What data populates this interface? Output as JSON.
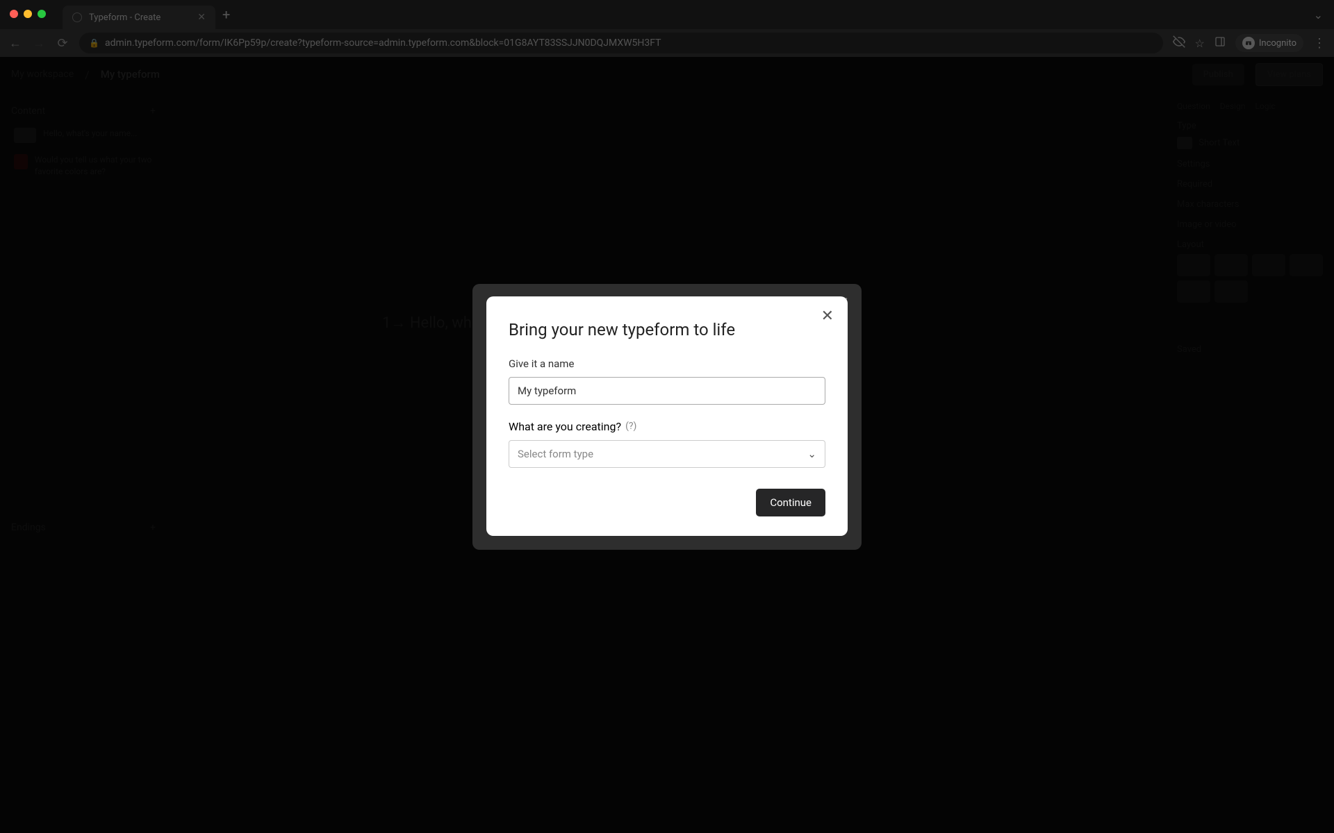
{
  "browser": {
    "tab_title": "Typeform - Create",
    "url": "admin.typeform.com/form/IK6Pp59p/create?typeform-source=admin.typeform.com&block=01G8AYT83SSJJN0DQJMXW5H3FT",
    "incognito_label": "Incognito"
  },
  "app": {
    "breadcrumb": "My workspace",
    "title": "My typeform",
    "publish_button": "Publish",
    "viewplans_button": "View plans",
    "sidebar": {
      "content_label": "Content",
      "questions": [
        {
          "label": "Hello, what's your name..."
        },
        {
          "label": "Would you tell us what your two favorite colors are?"
        }
      ],
      "endings_label": "Endings"
    },
    "canvas": {
      "question_prefix": "1→",
      "question_text": "Hello, wha"
    },
    "rightpanel": {
      "tabs": [
        "Question",
        "Design",
        "Logic"
      ],
      "type_label": "Type",
      "type_value": "Short Text",
      "settings_label": "Settings",
      "required_label": "Required",
      "max_chars_label": "Max characters",
      "image_video_label": "Image or video",
      "layout_label": "Layout",
      "saved_label": "Saved"
    }
  },
  "modal": {
    "title": "Bring your new typeform to life",
    "name_label": "Give it a name",
    "name_value": "My typeform",
    "creating_label": "What are you creating?",
    "creating_hint": "(?)",
    "select_placeholder": "Select form type",
    "continue_label": "Continue"
  }
}
